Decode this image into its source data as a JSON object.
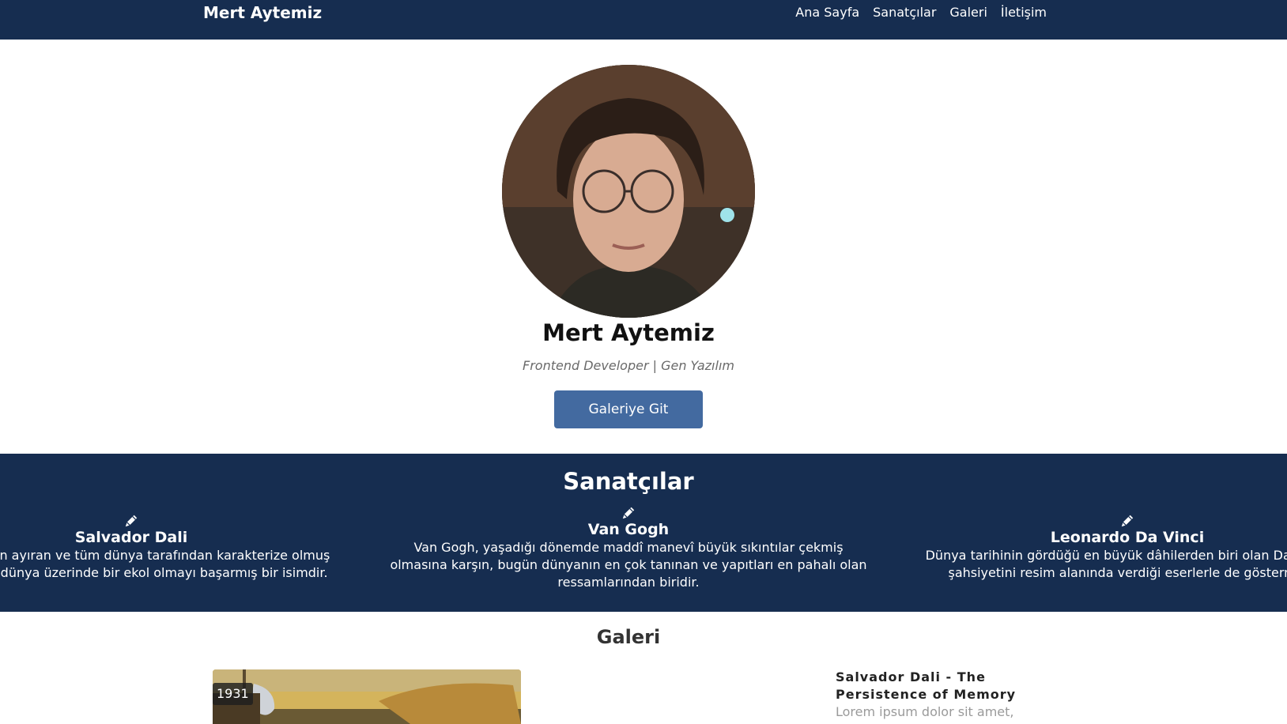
{
  "nav": {
    "brand": "Mert Aytemiz",
    "links": [
      "Ana Sayfa",
      "Sanatçılar",
      "Galeri",
      "İletişim"
    ]
  },
  "hero": {
    "name": "Mert Aytemiz",
    "subtitle": "Frontend Developer | Gen Yazılım",
    "button": "Galeriye Git"
  },
  "artists": {
    "title": "Sanatçılar",
    "items": [
      {
        "icon": "pencil-icon",
        "name": "Salvador Dali",
        "desc_lines": [
          "n herkesten ayıran ve tüm dünya tarafından karakterize olmuş",
          "şı tavrıyla dünya üzerinde bir ekol olmayı başarmış bir isimdir."
        ]
      },
      {
        "icon": "pencil-icon",
        "name": "Van Gogh",
        "desc": "Van Gogh, yaşadığı dönemde maddî manevî büyük sıkıntılar çekmiş olmasına karşın, bugün dünyanın en çok tanınan ve yapıtları en pahalı olan ressamlarından biridir."
      },
      {
        "icon": "pencil-icon",
        "name": "Leonardo Da Vinci",
        "desc_lines": [
          "Dünya tarihinin gördüğü en büyük dâhilerden biri olan Da Vinci,",
          "şahsiyetini resim alanında verdiği eserlerle de göstermiş"
        ]
      }
    ]
  },
  "gallery": {
    "title": "Galeri",
    "year": "1931",
    "caption_title": "Salvador Dali - The Persistence of Memory",
    "caption_text": "Lorem ipsum dolor sit amet,"
  },
  "colors": {
    "navy": "#162d50",
    "button": "#436aa0"
  }
}
